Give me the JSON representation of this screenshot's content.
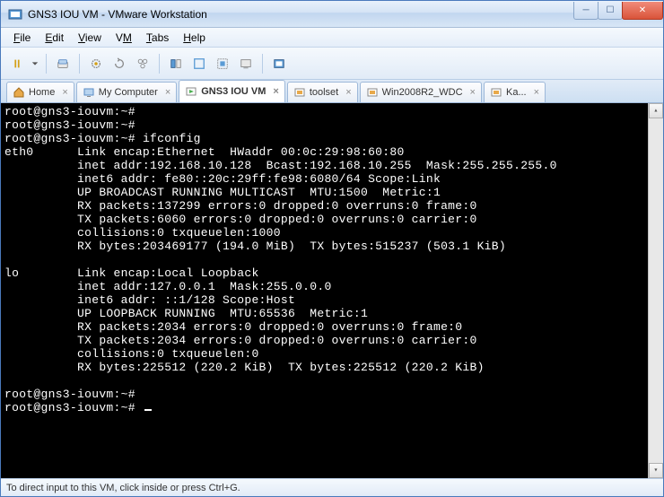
{
  "window": {
    "title": "GNS3 IOU VM - VMware Workstation"
  },
  "menu": {
    "file": "File",
    "edit": "Edit",
    "view": "View",
    "vm": "VM",
    "tabs": "Tabs",
    "help": "Help"
  },
  "tabs": {
    "home": "Home",
    "mycomputer": "My Computer",
    "gns3": "GNS3 IOU VM",
    "toolset": "toolset",
    "win2008": "Win2008R2_WDC",
    "ka": "Ka..."
  },
  "terminal": {
    "prompt": "root@gns3-iouvm:~#",
    "cmd": "ifconfig",
    "eth0": {
      "iface": "eth0",
      "l1": "Link encap:Ethernet  HWaddr 00:0c:29:98:60:80",
      "l2": "inet addr:192.168.10.128  Bcast:192.168.10.255  Mask:255.255.255.0",
      "l3": "inet6 addr: fe80::20c:29ff:fe98:6080/64 Scope:Link",
      "l4": "UP BROADCAST RUNNING MULTICAST  MTU:1500  Metric:1",
      "l5": "RX packets:137299 errors:0 dropped:0 overruns:0 frame:0",
      "l6": "TX packets:6060 errors:0 dropped:0 overruns:0 carrier:0",
      "l7": "collisions:0 txqueuelen:1000",
      "l8": "RX bytes:203469177 (194.0 MiB)  TX bytes:515237 (503.1 KiB)"
    },
    "lo": {
      "iface": "lo",
      "l1": "Link encap:Local Loopback",
      "l2": "inet addr:127.0.0.1  Mask:255.0.0.0",
      "l3": "inet6 addr: ::1/128 Scope:Host",
      "l4": "UP LOOPBACK RUNNING  MTU:65536  Metric:1",
      "l5": "RX packets:2034 errors:0 dropped:0 overruns:0 frame:0",
      "l6": "TX packets:2034 errors:0 dropped:0 overruns:0 carrier:0",
      "l7": "collisions:0 txqueuelen:0",
      "l8": "RX bytes:225512 (220.2 KiB)  TX bytes:225512 (220.2 KiB)"
    }
  },
  "status": {
    "msg": "To direct input to this VM, click inside or press Ctrl+G."
  },
  "colors": {
    "terminal_bg": "#000000",
    "terminal_fg": "#ffffff"
  }
}
